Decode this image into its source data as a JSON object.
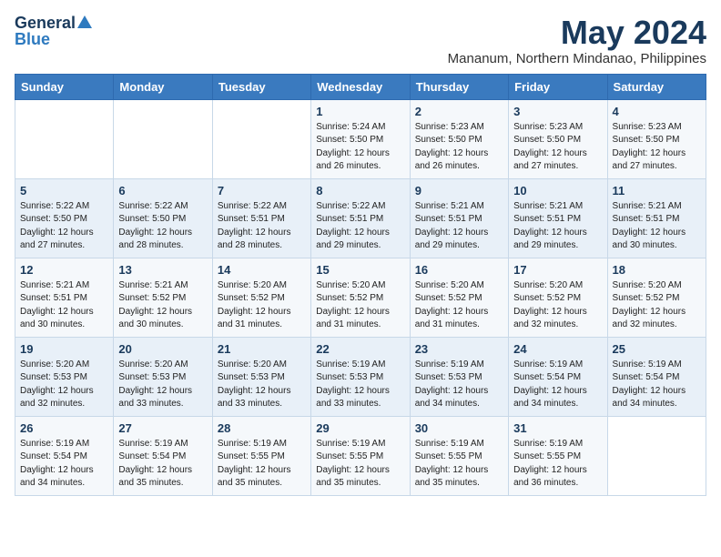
{
  "logo": {
    "general": "General",
    "blue": "Blue"
  },
  "title": "May 2024",
  "location": "Mananum, Northern Mindanao, Philippines",
  "weekdays": [
    "Sunday",
    "Monday",
    "Tuesday",
    "Wednesday",
    "Thursday",
    "Friday",
    "Saturday"
  ],
  "weeks": [
    [
      {
        "day": "",
        "sunrise": "",
        "sunset": "",
        "daylight": ""
      },
      {
        "day": "",
        "sunrise": "",
        "sunset": "",
        "daylight": ""
      },
      {
        "day": "",
        "sunrise": "",
        "sunset": "",
        "daylight": ""
      },
      {
        "day": "1",
        "sunrise": "5:24 AM",
        "sunset": "5:50 PM",
        "daylight": "12 hours and 26 minutes."
      },
      {
        "day": "2",
        "sunrise": "5:23 AM",
        "sunset": "5:50 PM",
        "daylight": "12 hours and 26 minutes."
      },
      {
        "day": "3",
        "sunrise": "5:23 AM",
        "sunset": "5:50 PM",
        "daylight": "12 hours and 27 minutes."
      },
      {
        "day": "4",
        "sunrise": "5:23 AM",
        "sunset": "5:50 PM",
        "daylight": "12 hours and 27 minutes."
      }
    ],
    [
      {
        "day": "5",
        "sunrise": "5:22 AM",
        "sunset": "5:50 PM",
        "daylight": "12 hours and 27 minutes."
      },
      {
        "day": "6",
        "sunrise": "5:22 AM",
        "sunset": "5:50 PM",
        "daylight": "12 hours and 28 minutes."
      },
      {
        "day": "7",
        "sunrise": "5:22 AM",
        "sunset": "5:51 PM",
        "daylight": "12 hours and 28 minutes."
      },
      {
        "day": "8",
        "sunrise": "5:22 AM",
        "sunset": "5:51 PM",
        "daylight": "12 hours and 29 minutes."
      },
      {
        "day": "9",
        "sunrise": "5:21 AM",
        "sunset": "5:51 PM",
        "daylight": "12 hours and 29 minutes."
      },
      {
        "day": "10",
        "sunrise": "5:21 AM",
        "sunset": "5:51 PM",
        "daylight": "12 hours and 29 minutes."
      },
      {
        "day": "11",
        "sunrise": "5:21 AM",
        "sunset": "5:51 PM",
        "daylight": "12 hours and 30 minutes."
      }
    ],
    [
      {
        "day": "12",
        "sunrise": "5:21 AM",
        "sunset": "5:51 PM",
        "daylight": "12 hours and 30 minutes."
      },
      {
        "day": "13",
        "sunrise": "5:21 AM",
        "sunset": "5:52 PM",
        "daylight": "12 hours and 30 minutes."
      },
      {
        "day": "14",
        "sunrise": "5:20 AM",
        "sunset": "5:52 PM",
        "daylight": "12 hours and 31 minutes."
      },
      {
        "day": "15",
        "sunrise": "5:20 AM",
        "sunset": "5:52 PM",
        "daylight": "12 hours and 31 minutes."
      },
      {
        "day": "16",
        "sunrise": "5:20 AM",
        "sunset": "5:52 PM",
        "daylight": "12 hours and 31 minutes."
      },
      {
        "day": "17",
        "sunrise": "5:20 AM",
        "sunset": "5:52 PM",
        "daylight": "12 hours and 32 minutes."
      },
      {
        "day": "18",
        "sunrise": "5:20 AM",
        "sunset": "5:52 PM",
        "daylight": "12 hours and 32 minutes."
      }
    ],
    [
      {
        "day": "19",
        "sunrise": "5:20 AM",
        "sunset": "5:53 PM",
        "daylight": "12 hours and 32 minutes."
      },
      {
        "day": "20",
        "sunrise": "5:20 AM",
        "sunset": "5:53 PM",
        "daylight": "12 hours and 33 minutes."
      },
      {
        "day": "21",
        "sunrise": "5:20 AM",
        "sunset": "5:53 PM",
        "daylight": "12 hours and 33 minutes."
      },
      {
        "day": "22",
        "sunrise": "5:19 AM",
        "sunset": "5:53 PM",
        "daylight": "12 hours and 33 minutes."
      },
      {
        "day": "23",
        "sunrise": "5:19 AM",
        "sunset": "5:53 PM",
        "daylight": "12 hours and 34 minutes."
      },
      {
        "day": "24",
        "sunrise": "5:19 AM",
        "sunset": "5:54 PM",
        "daylight": "12 hours and 34 minutes."
      },
      {
        "day": "25",
        "sunrise": "5:19 AM",
        "sunset": "5:54 PM",
        "daylight": "12 hours and 34 minutes."
      }
    ],
    [
      {
        "day": "26",
        "sunrise": "5:19 AM",
        "sunset": "5:54 PM",
        "daylight": "12 hours and 34 minutes."
      },
      {
        "day": "27",
        "sunrise": "5:19 AM",
        "sunset": "5:54 PM",
        "daylight": "12 hours and 35 minutes."
      },
      {
        "day": "28",
        "sunrise": "5:19 AM",
        "sunset": "5:55 PM",
        "daylight": "12 hours and 35 minutes."
      },
      {
        "day": "29",
        "sunrise": "5:19 AM",
        "sunset": "5:55 PM",
        "daylight": "12 hours and 35 minutes."
      },
      {
        "day": "30",
        "sunrise": "5:19 AM",
        "sunset": "5:55 PM",
        "daylight": "12 hours and 35 minutes."
      },
      {
        "day": "31",
        "sunrise": "5:19 AM",
        "sunset": "5:55 PM",
        "daylight": "12 hours and 36 minutes."
      },
      {
        "day": "",
        "sunrise": "",
        "sunset": "",
        "daylight": ""
      }
    ]
  ],
  "labels": {
    "sunrise_prefix": "Sunrise: ",
    "sunset_prefix": "Sunset: ",
    "daylight_prefix": "Daylight: "
  }
}
